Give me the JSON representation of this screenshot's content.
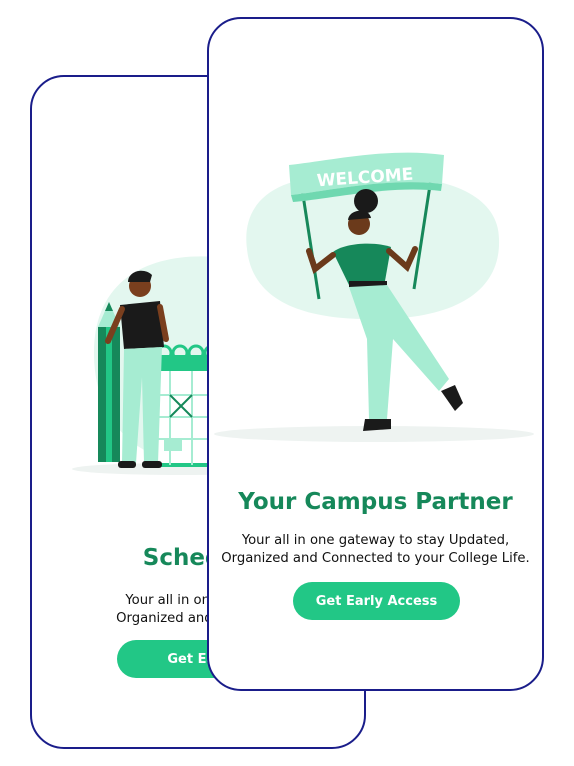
{
  "screens": [
    {
      "title": "Schedule",
      "description_line1": "Your all in one gateway",
      "description_line2": "Organized and Connected",
      "cta_label": "Get Early",
      "illustration": "person-with-pencil-and-calendar"
    },
    {
      "title": "Your Campus Partner",
      "description_line1": "Your all in one gateway to stay Updated,",
      "description_line2": "Organized and Connected to your College Life.",
      "cta_label": "Get Early Access",
      "banner_text": "WELCOME",
      "illustration": "person-holding-welcome-banner"
    }
  ],
  "colors": {
    "frame_border": "#1a1d8a",
    "accent_green": "#22c786",
    "title_green": "#16885a",
    "blob_mint": "#e3f7ef",
    "clothes_light": "#a6ecd2"
  }
}
